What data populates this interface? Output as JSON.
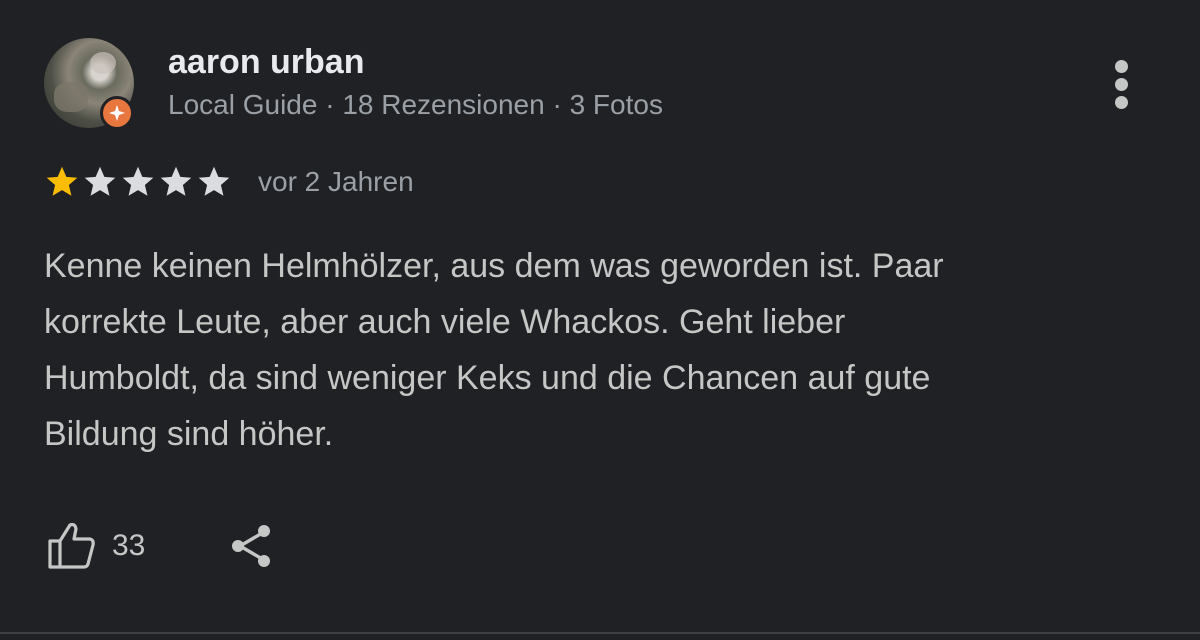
{
  "review": {
    "author": {
      "name": "aaron urban",
      "meta": "Local Guide · 18 Rezensionen · 3 Fotos",
      "avatar_icon": "user-photo",
      "badge_icon": "local-guide-star-badge"
    },
    "rating": {
      "value": 1,
      "max": 5,
      "filled_color": "#fbbc04",
      "empty_color": "#dadce0"
    },
    "time": "vor 2 Jahren",
    "text_lines": [
      "Kenne keinen Helmhölzer, aus dem was geworden ist. Paar",
      "korrekte Leute, aber auch viele Whackos. Geht lieber",
      "Humboldt, da sind weniger Keks und die Chancen auf gute",
      "Bildung sind höher."
    ],
    "likes": {
      "count": "33",
      "icon": "thumbs-up-icon"
    },
    "share_icon": "share-icon",
    "more_icon": "more-vert-icon"
  },
  "colors": {
    "background": "#202124",
    "accent_orange": "#e8763f"
  }
}
